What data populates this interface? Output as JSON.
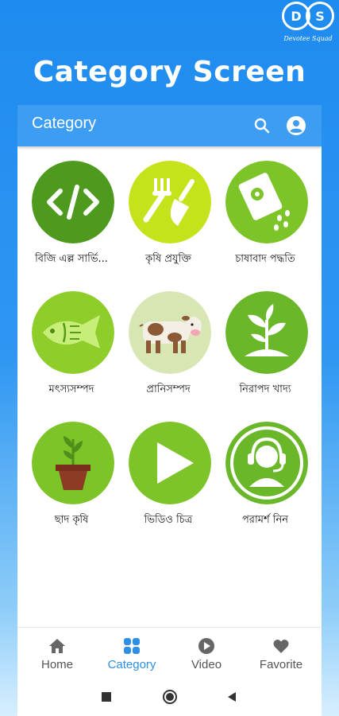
{
  "brand": {
    "letters": [
      "D",
      "S"
    ],
    "tagline": "Devotee Squad"
  },
  "headline": "Category Screen",
  "appbar": {
    "title": "Category",
    "search_icon": "search-icon",
    "account_icon": "account-icon"
  },
  "categories": [
    {
      "label": "বিজি এল্ল সার্ভি...",
      "icon": "code-icon"
    },
    {
      "label": "কৃষি প্রযুক্তি",
      "icon": "garden-tools-icon"
    },
    {
      "label": "চাষাবাদ পদ্ধতি",
      "icon": "seed-packet-icon"
    },
    {
      "label": "মৎস্যসম্পদ",
      "icon": "fish-icon"
    },
    {
      "label": "প্রানিসম্পদ",
      "icon": "cow-icon"
    },
    {
      "label": "নিরাপদ খাদ্য",
      "icon": "plant-icon"
    },
    {
      "label": "ছাদ কৃষি",
      "icon": "potted-plant-icon"
    },
    {
      "label": "ভিডিও চিত্র",
      "icon": "play-icon"
    },
    {
      "label": "পরামর্শ নিন",
      "icon": "headset-support-icon"
    }
  ],
  "bottom_nav": [
    {
      "label": "Home",
      "icon": "home-icon",
      "active": false
    },
    {
      "label": "Category",
      "icon": "grid-icon",
      "active": true
    },
    {
      "label": "Video",
      "icon": "play-circle-icon",
      "active": false
    },
    {
      "label": "Favorite",
      "icon": "heart-icon",
      "active": false
    }
  ],
  "colors": {
    "background_top": "#1e8bf0",
    "appbar": "#3d9df3",
    "active_nav": "#2f8ee8",
    "circle_dark_green": "#4d9a1e",
    "circle_lime": "#c5e21a",
    "circle_green": "#7cc428"
  }
}
